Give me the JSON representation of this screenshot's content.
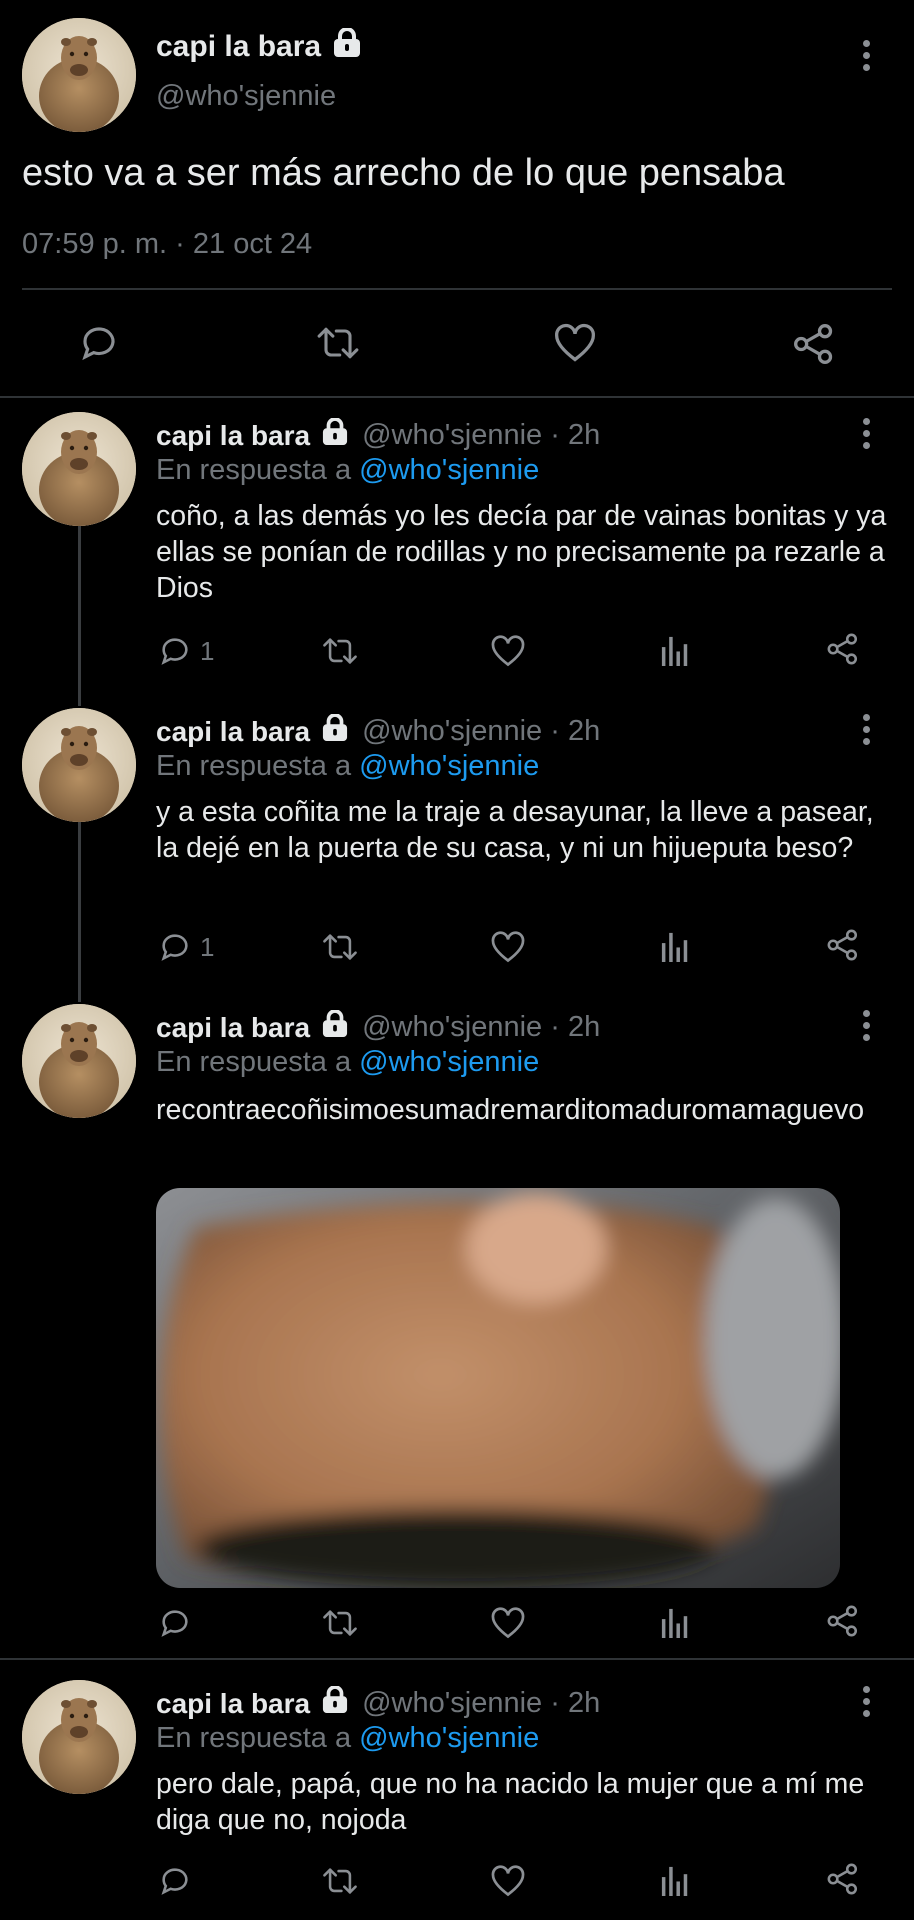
{
  "main_tweet": {
    "author_name": "capi la bara",
    "handle": "@who'sjennie",
    "text": "esto va a ser más arrecho de lo que pensaba",
    "time": "07:59 p. m.",
    "date_sep": " · ",
    "date": "21 oct 24"
  },
  "replies": [
    {
      "author_name": "capi la bara",
      "handle_time": "@who'sjennie · 2h",
      "in_reply_prefix": "En respuesta a ",
      "in_reply_to": "@who'sjennie",
      "text": "coño, a las demás yo les decía par de vainas bonitas y ya ellas se ponían de rodillas y no precisamente pa rezarle a Dios",
      "reply_count": "1"
    },
    {
      "author_name": "capi la bara",
      "handle_time": "@who'sjennie · 2h",
      "in_reply_prefix": "En respuesta a ",
      "in_reply_to": "@who'sjennie",
      "text": "y a esta coñita me la traje a desayunar, la lleve a pasear, la dejé en la puerta de su casa, y ni un hijueputa beso?",
      "reply_count": "1"
    },
    {
      "author_name": "capi la bara",
      "handle_time": "@who'sjennie · 2h",
      "in_reply_prefix": "En respuesta a ",
      "in_reply_to": "@who'sjennie",
      "text": "recontraecoñisimoesumadremarditomaduromamaguevo",
      "reply_count": ""
    },
    {
      "author_name": "capi la bara",
      "handle_time": "@who'sjennie · 2h",
      "in_reply_prefix": "En respuesta a ",
      "in_reply_to": "@who'sjennie",
      "text": "pero dale, papá, que no ha nacido la mujer que a mí me diga que no, nojoda",
      "reply_count": ""
    }
  ],
  "icons": {
    "reply": "reply-icon",
    "retweet": "retweet-icon",
    "like": "heart-icon",
    "views": "views-icon",
    "share": "share-icon",
    "lock": "lock-icon",
    "more": "more-icon"
  },
  "colors": {
    "background": "#000000",
    "text": "#e7e9ea",
    "muted": "#71767b",
    "link": "#1d9bf0",
    "divider": "#2f3336"
  }
}
